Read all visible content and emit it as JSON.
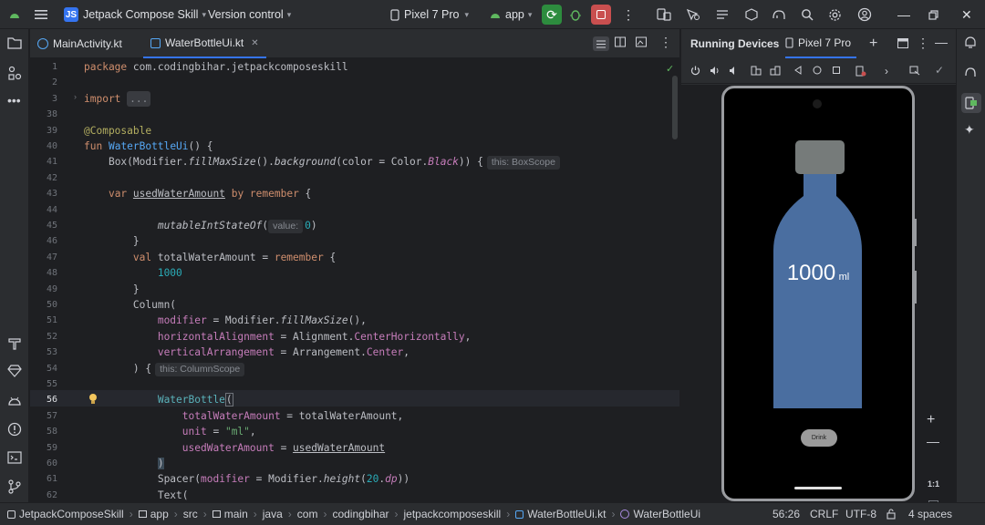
{
  "titlebar": {
    "project_badge": "JS",
    "project_name": "Jetpack Compose Skill",
    "vcs_label": "Version control",
    "device_name": "Pixel 7 Pro",
    "run_config": "app"
  },
  "tabs": [
    {
      "label": "MainActivity.kt"
    },
    {
      "label": "WaterBottleUi.kt"
    }
  ],
  "editor": {
    "line_numbers": [
      "1",
      "2",
      "3",
      "38",
      "39",
      "40",
      "41",
      "42",
      "43",
      "44",
      "45",
      "46",
      "47",
      "48",
      "49",
      "50",
      "51",
      "52",
      "53",
      "54",
      "55",
      "56",
      "57",
      "58",
      "59",
      "60",
      "61",
      "62"
    ],
    "lines": {
      "l1_kw": "package",
      "l1_rest": " com.codingbihar.jetpackcomposeskill",
      "l3_kw": "import",
      "l3_fold": "...",
      "l39": "@Composable",
      "l40_kw": "fun",
      "l40_fn": "WaterBottleUi",
      "l40_rest": "() {",
      "l41_a": "Box(Modifier.",
      "l41_b": "fillMaxSize",
      "l41_c": "().",
      "l41_d": "background",
      "l41_e": "(color = Color.",
      "l41_f": "Black",
      "l41_g": ")) {",
      "l41_hint": "this: BoxScope",
      "l43_kw": "var",
      "l43_var": "usedWaterAmount",
      "l43_by": " by ",
      "l43_fn": "remember",
      "l43_rest": " {",
      "l45_fn": "mutableIntStateOf",
      "l45_open": "(",
      "l45_hint": "value:",
      "l45_num": "0",
      "l45_close": ")",
      "l46": "}",
      "l47_kw": "val",
      "l47_a": " totalWaterAmount = ",
      "l47_fn": "remember",
      "l47_b": " {",
      "l48": "1000",
      "l49": "}",
      "l50": "Column(",
      "l51_p": "modifier",
      "l51_a": " = Modifier.",
      "l51_f": "fillMaxSize",
      "l51_b": "(),",
      "l52_p": "horizontalAlignment",
      "l52_a": " = Alignment.",
      "l52_v": "CenterHorizontally",
      "l52_b": ",",
      "l53_p": "verticalArrangement",
      "l53_a": " = Arrangement.",
      "l53_v": "Center",
      "l53_b": ",",
      "l54_a": ") {",
      "l54_hint": "this: ColumnScope",
      "l56_a": "WaterBottle",
      "l56_b": "(",
      "l57_p": "totalWaterAmount",
      "l57_a": " = totalWaterAmount,",
      "l58_p": "unit",
      "l58_a": " = ",
      "l58_s": "\"ml\"",
      "l58_b": ",",
      "l59_p": "usedWaterAmount",
      "l59_a": " = ",
      "l59_v": "usedWaterAmount",
      "l60": ")",
      "l61_a": "Spacer(",
      "l61_p": "modifier",
      "l61_b": " = Modifier.",
      "l61_f": "height",
      "l61_c": "(",
      "l61_n": "20",
      "l61_d": ".",
      "l61_dp": "dp",
      "l61_e": "))",
      "l62": "Text("
    }
  },
  "running_devices": {
    "title": "Running Devices",
    "device_tab": "Pixel 7 Pro",
    "app": {
      "amount": "1000",
      "unit": "ml",
      "button_label": "Drink",
      "water_fill_fraction": 1.0,
      "bottle_color": "#4a6ea0",
      "cap_color": "#767b7a"
    },
    "zoom_label": "1:1"
  },
  "statusbar": {
    "crumbs": [
      "JetpackComposeSkill",
      "app",
      "src",
      "main",
      "java",
      "com",
      "codingbihar",
      "jetpackcomposeskill",
      "WaterBottleUi.kt",
      "WaterBottleUi"
    ],
    "position": "56:26",
    "line_sep": "CRLF",
    "encoding": "UTF-8",
    "indent": "4 spaces"
  },
  "colors": {
    "accent": "#3574f0",
    "run_green": "#2d8c3e",
    "stop_red": "#c94f4f"
  }
}
